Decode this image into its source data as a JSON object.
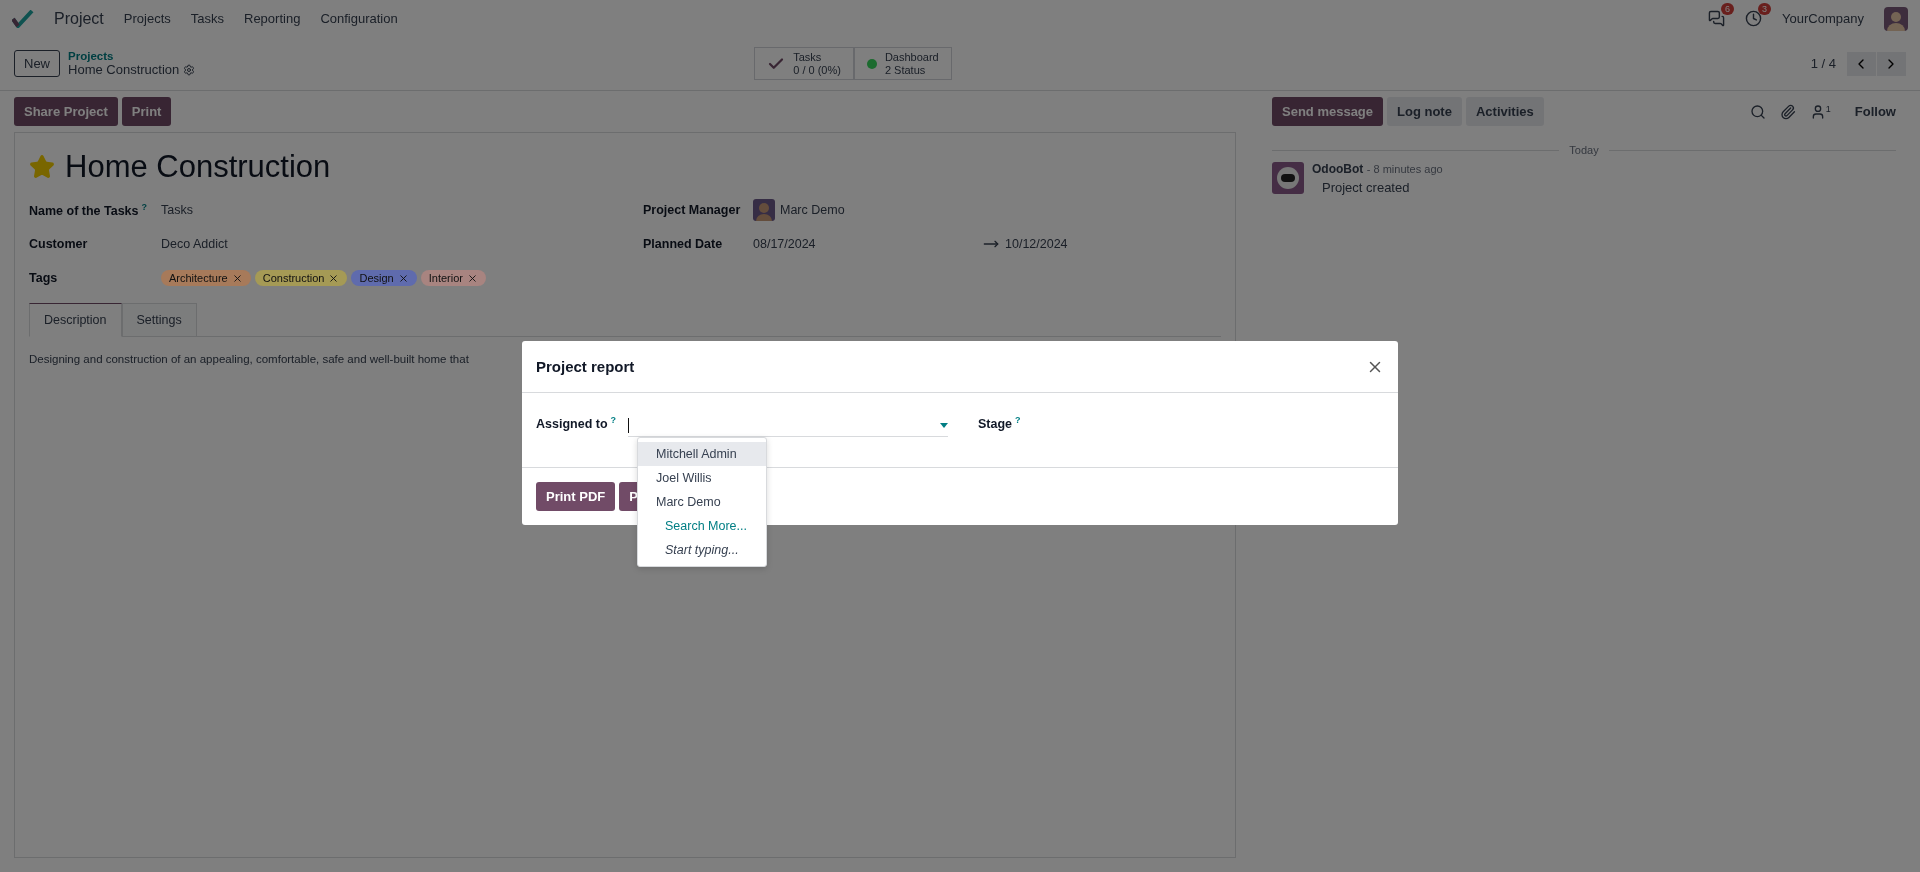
{
  "navbar": {
    "app": "Project",
    "menu": [
      "Projects",
      "Tasks",
      "Reporting",
      "Configuration"
    ],
    "messages_badge": "6",
    "activities_badge": "3",
    "company": "YourCompany"
  },
  "control_panel": {
    "new_button": "New",
    "breadcrumb": "Projects",
    "record": "Home Construction",
    "stats": [
      {
        "kind": "check",
        "label": "Tasks",
        "value": "0 / 0 (0%)"
      },
      {
        "kind": "dot",
        "label": "Dashboard",
        "value": "2 Status",
        "color": "#1c6b2f"
      }
    ],
    "pager": "1 / 4"
  },
  "actions": [
    "Share Project",
    "Print"
  ],
  "form": {
    "title": "Home Construction",
    "favorite": true,
    "left_fields": [
      {
        "label": "Name of the Tasks",
        "help": "?",
        "value": "Tasks"
      },
      {
        "label": "Customer",
        "value": "Deco Addict"
      }
    ],
    "tags_label": "Tags",
    "tags": [
      {
        "name": "Architecture",
        "color": "#a77a5a"
      },
      {
        "name": "Construction",
        "color": "#a59a55"
      },
      {
        "name": "Design",
        "color": "#5f6bad"
      },
      {
        "name": "Interior",
        "color": "#a88480"
      }
    ],
    "manager_label": "Project Manager",
    "manager": "Marc Demo",
    "date_label": "Planned Date",
    "date_start": "08/17/2024",
    "date_end": "10/12/2024",
    "tabs": [
      {
        "label": "Description",
        "selected": true
      },
      {
        "label": "Settings",
        "selected": false
      }
    ],
    "description": "Designing and construction of an appealing, comfortable, safe and well-built home that"
  },
  "chatter": {
    "buttons": [
      {
        "label": "Send message",
        "selected": true
      },
      {
        "label": "Log note",
        "selected": false
      },
      {
        "label": "Activities",
        "selected": false
      }
    ],
    "followers_count": "1",
    "follow": "Follow",
    "separator": "Today",
    "messages": [
      {
        "author": "OdooBot",
        "time": "- 8 minutes ago",
        "body": "Project created"
      }
    ]
  },
  "dialog": {
    "title": "Project report",
    "assigned_label": "Assigned to",
    "assigned_help": "?",
    "stage_label": "Stage",
    "stage_help": "?",
    "buttons": [
      "Print PDF",
      "P"
    ],
    "dropdown": [
      {
        "kind": "option",
        "label": "Mitchell Admin",
        "selected": true
      },
      {
        "kind": "option",
        "label": "Joel Willis",
        "selected": false
      },
      {
        "kind": "option",
        "label": "Marc Demo",
        "selected": false
      },
      {
        "kind": "link",
        "label": "Search More..."
      },
      {
        "kind": "hint",
        "label": "Start typing..."
      }
    ]
  }
}
